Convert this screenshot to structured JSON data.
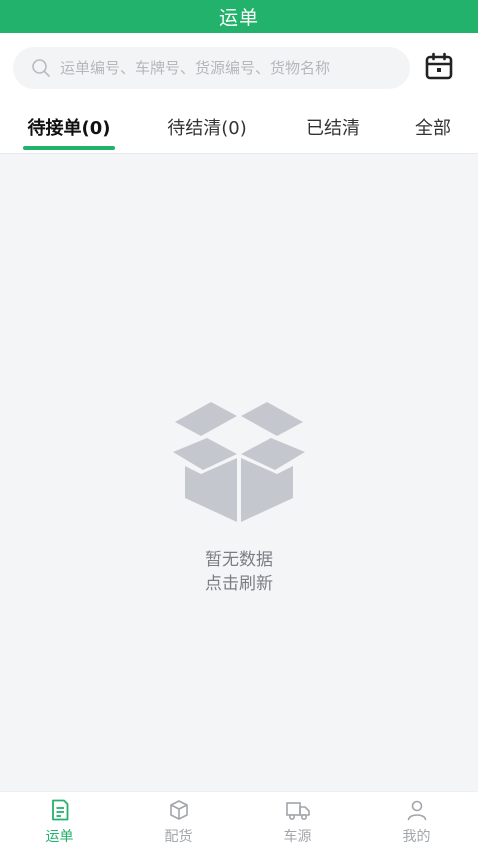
{
  "header": {
    "title": "运单"
  },
  "search": {
    "placeholder": "运单编号、车牌号、货源编号、货物名称",
    "value": ""
  },
  "tabs": [
    {
      "label": "待接单(0)",
      "active": true
    },
    {
      "label": "待结清(0)",
      "active": false
    },
    {
      "label": "已结清",
      "active": false
    },
    {
      "label": "全部",
      "active": false
    }
  ],
  "empty": {
    "line1": "暂无数据",
    "line2": "点击刷新"
  },
  "bottom_nav": [
    {
      "label": "运单",
      "icon": "waybill-icon",
      "active": true
    },
    {
      "label": "配货",
      "icon": "package-icon",
      "active": false
    },
    {
      "label": "车源",
      "icon": "truck-icon",
      "active": false
    },
    {
      "label": "我的",
      "icon": "user-icon",
      "active": false
    }
  ],
  "colors": {
    "brand": "#23b26b",
    "inactive": "#a2a5aa",
    "background": "#f4f5f7"
  }
}
